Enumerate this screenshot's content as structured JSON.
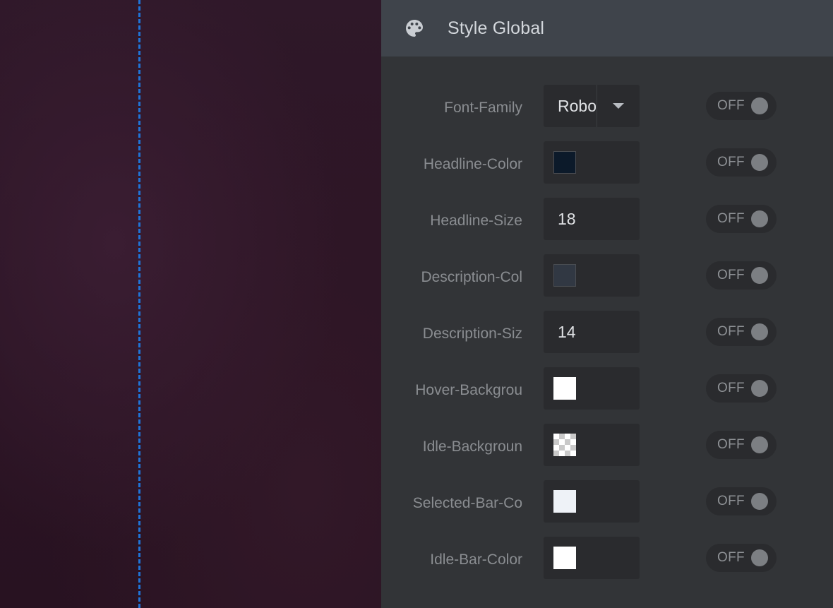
{
  "panel": {
    "title": "Style Global",
    "header_icon": "palette-icon"
  },
  "rows": [
    {
      "label": "Font-Family",
      "type": "select",
      "value": "Robo",
      "toggle": "OFF"
    },
    {
      "label": "Headline-Color",
      "type": "color",
      "color": "#0c1a2a",
      "toggle": "OFF"
    },
    {
      "label": "Headline-Size",
      "type": "number",
      "value": "18",
      "toggle": "OFF"
    },
    {
      "label": "Description-Col",
      "type": "color",
      "color": "#313843",
      "toggle": "OFF"
    },
    {
      "label": "Description-Siz",
      "type": "number",
      "value": "14",
      "toggle": "OFF"
    },
    {
      "label": "Hover-Backgrou",
      "type": "color",
      "color": "#ffffff",
      "toggle": "OFF"
    },
    {
      "label": "Idle-Backgroun",
      "type": "color",
      "color": "transparent",
      "toggle": "OFF"
    },
    {
      "label": "Selected-Bar-Co",
      "type": "color",
      "color": "#eef2f7",
      "toggle": "OFF"
    },
    {
      "label": "Idle-Bar-Color",
      "type": "color",
      "color": "#ffffff",
      "toggle": "OFF"
    }
  ],
  "colors": {
    "guide_line": "#1f74d8",
    "panel_bg": "#323437",
    "header_bg": "#3f444b"
  }
}
